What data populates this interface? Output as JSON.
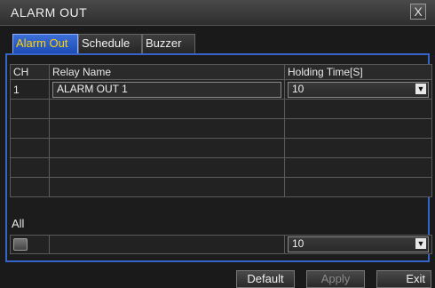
{
  "window": {
    "title": "ALARM OUT",
    "close_symbol": "X"
  },
  "tabs": [
    {
      "label": "Alarm Out",
      "active": true
    },
    {
      "label": "Schedule",
      "active": false
    },
    {
      "label": "Buzzer",
      "active": false
    }
  ],
  "table": {
    "headers": {
      "ch": "CH",
      "relay_name": "Relay Name",
      "holding_time": "Holding Time[S]"
    },
    "rows": [
      {
        "ch": "1",
        "relay_name": "ALARM OUT 1",
        "holding_time": "10"
      }
    ]
  },
  "all": {
    "label": "All",
    "holding_time": "10"
  },
  "buttons": {
    "default": "Default",
    "apply": "Apply",
    "exit": "Exit"
  },
  "colors": {
    "accent": "#3565c9",
    "active_tab_text": "#ffd200"
  }
}
